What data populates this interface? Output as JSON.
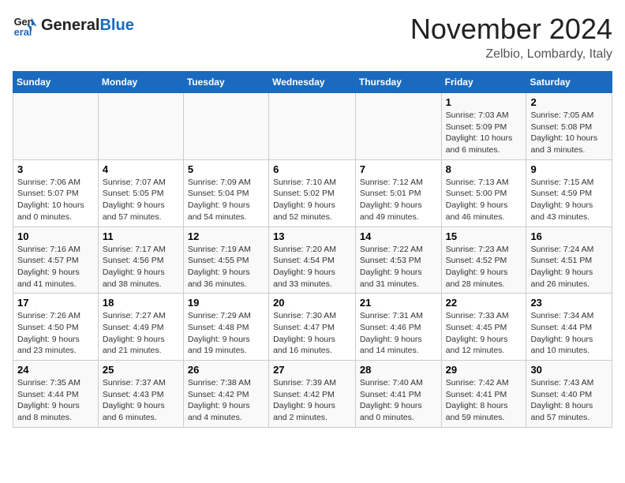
{
  "header": {
    "logo_line1": "General",
    "logo_line2": "Blue",
    "month": "November 2024",
    "location": "Zelbio, Lombardy, Italy"
  },
  "weekdays": [
    "Sunday",
    "Monday",
    "Tuesday",
    "Wednesday",
    "Thursday",
    "Friday",
    "Saturday"
  ],
  "weeks": [
    [
      {
        "day": "",
        "info": ""
      },
      {
        "day": "",
        "info": ""
      },
      {
        "day": "",
        "info": ""
      },
      {
        "day": "",
        "info": ""
      },
      {
        "day": "",
        "info": ""
      },
      {
        "day": "1",
        "info": "Sunrise: 7:03 AM\nSunset: 5:09 PM\nDaylight: 10 hours and 6 minutes."
      },
      {
        "day": "2",
        "info": "Sunrise: 7:05 AM\nSunset: 5:08 PM\nDaylight: 10 hours and 3 minutes."
      }
    ],
    [
      {
        "day": "3",
        "info": "Sunrise: 7:06 AM\nSunset: 5:07 PM\nDaylight: 10 hours and 0 minutes."
      },
      {
        "day": "4",
        "info": "Sunrise: 7:07 AM\nSunset: 5:05 PM\nDaylight: 9 hours and 57 minutes."
      },
      {
        "day": "5",
        "info": "Sunrise: 7:09 AM\nSunset: 5:04 PM\nDaylight: 9 hours and 54 minutes."
      },
      {
        "day": "6",
        "info": "Sunrise: 7:10 AM\nSunset: 5:02 PM\nDaylight: 9 hours and 52 minutes."
      },
      {
        "day": "7",
        "info": "Sunrise: 7:12 AM\nSunset: 5:01 PM\nDaylight: 9 hours and 49 minutes."
      },
      {
        "day": "8",
        "info": "Sunrise: 7:13 AM\nSunset: 5:00 PM\nDaylight: 9 hours and 46 minutes."
      },
      {
        "day": "9",
        "info": "Sunrise: 7:15 AM\nSunset: 4:59 PM\nDaylight: 9 hours and 43 minutes."
      }
    ],
    [
      {
        "day": "10",
        "info": "Sunrise: 7:16 AM\nSunset: 4:57 PM\nDaylight: 9 hours and 41 minutes."
      },
      {
        "day": "11",
        "info": "Sunrise: 7:17 AM\nSunset: 4:56 PM\nDaylight: 9 hours and 38 minutes."
      },
      {
        "day": "12",
        "info": "Sunrise: 7:19 AM\nSunset: 4:55 PM\nDaylight: 9 hours and 36 minutes."
      },
      {
        "day": "13",
        "info": "Sunrise: 7:20 AM\nSunset: 4:54 PM\nDaylight: 9 hours and 33 minutes."
      },
      {
        "day": "14",
        "info": "Sunrise: 7:22 AM\nSunset: 4:53 PM\nDaylight: 9 hours and 31 minutes."
      },
      {
        "day": "15",
        "info": "Sunrise: 7:23 AM\nSunset: 4:52 PM\nDaylight: 9 hours and 28 minutes."
      },
      {
        "day": "16",
        "info": "Sunrise: 7:24 AM\nSunset: 4:51 PM\nDaylight: 9 hours and 26 minutes."
      }
    ],
    [
      {
        "day": "17",
        "info": "Sunrise: 7:26 AM\nSunset: 4:50 PM\nDaylight: 9 hours and 23 minutes."
      },
      {
        "day": "18",
        "info": "Sunrise: 7:27 AM\nSunset: 4:49 PM\nDaylight: 9 hours and 21 minutes."
      },
      {
        "day": "19",
        "info": "Sunrise: 7:29 AM\nSunset: 4:48 PM\nDaylight: 9 hours and 19 minutes."
      },
      {
        "day": "20",
        "info": "Sunrise: 7:30 AM\nSunset: 4:47 PM\nDaylight: 9 hours and 16 minutes."
      },
      {
        "day": "21",
        "info": "Sunrise: 7:31 AM\nSunset: 4:46 PM\nDaylight: 9 hours and 14 minutes."
      },
      {
        "day": "22",
        "info": "Sunrise: 7:33 AM\nSunset: 4:45 PM\nDaylight: 9 hours and 12 minutes."
      },
      {
        "day": "23",
        "info": "Sunrise: 7:34 AM\nSunset: 4:44 PM\nDaylight: 9 hours and 10 minutes."
      }
    ],
    [
      {
        "day": "24",
        "info": "Sunrise: 7:35 AM\nSunset: 4:44 PM\nDaylight: 9 hours and 8 minutes."
      },
      {
        "day": "25",
        "info": "Sunrise: 7:37 AM\nSunset: 4:43 PM\nDaylight: 9 hours and 6 minutes."
      },
      {
        "day": "26",
        "info": "Sunrise: 7:38 AM\nSunset: 4:42 PM\nDaylight: 9 hours and 4 minutes."
      },
      {
        "day": "27",
        "info": "Sunrise: 7:39 AM\nSunset: 4:42 PM\nDaylight: 9 hours and 2 minutes."
      },
      {
        "day": "28",
        "info": "Sunrise: 7:40 AM\nSunset: 4:41 PM\nDaylight: 9 hours and 0 minutes."
      },
      {
        "day": "29",
        "info": "Sunrise: 7:42 AM\nSunset: 4:41 PM\nDaylight: 8 hours and 59 minutes."
      },
      {
        "day": "30",
        "info": "Sunrise: 7:43 AM\nSunset: 4:40 PM\nDaylight: 8 hours and 57 minutes."
      }
    ]
  ]
}
